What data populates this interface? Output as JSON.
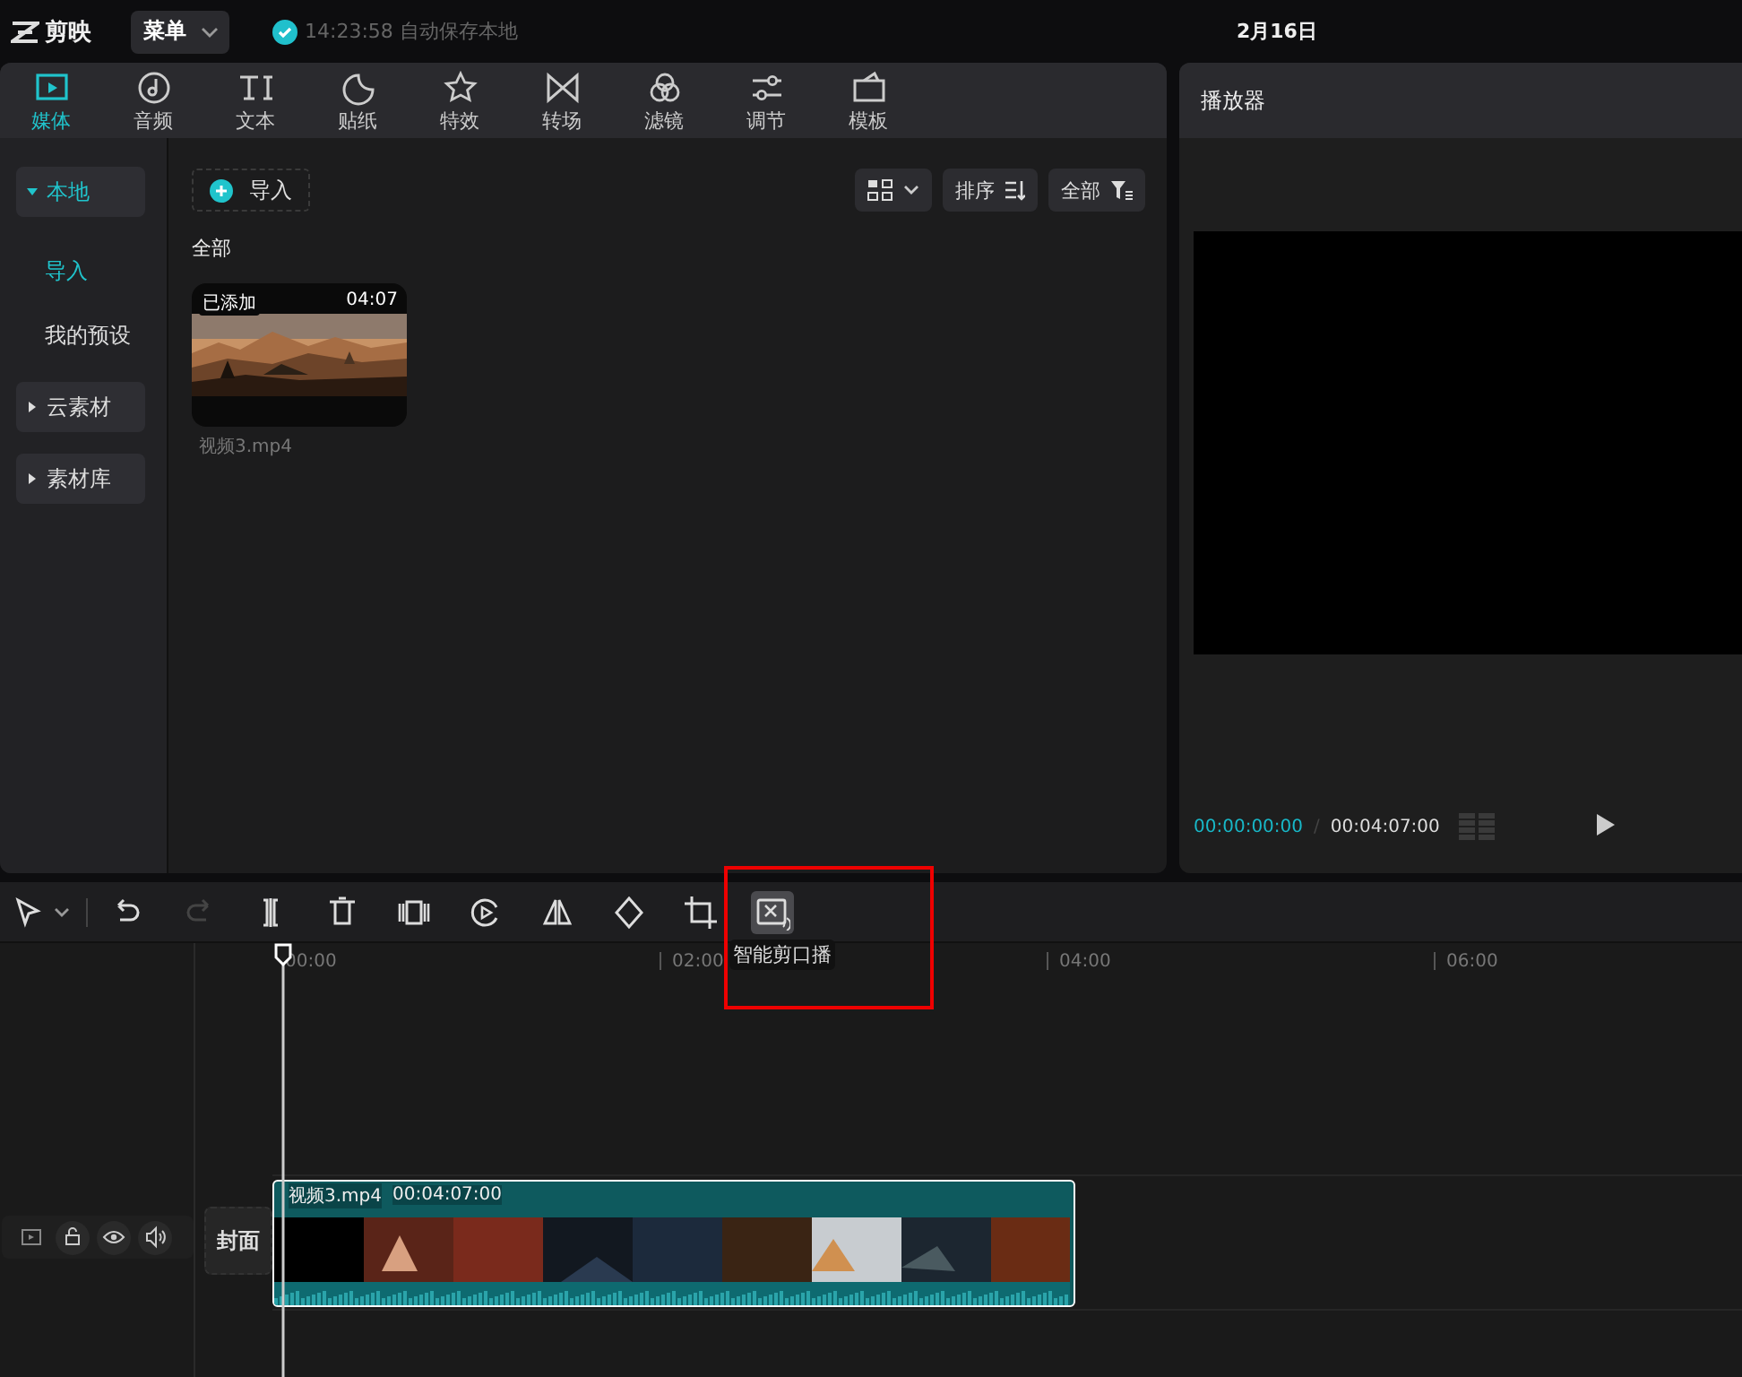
{
  "app": {
    "name": "剪映",
    "menu": "菜单",
    "save_status": "14:23:58 自动保存本地",
    "date": "2月16日"
  },
  "tabs": [
    {
      "label": "媒体",
      "selected": true
    },
    {
      "label": "音频",
      "selected": false
    },
    {
      "label": "文本",
      "selected": false
    },
    {
      "label": "贴纸",
      "selected": false
    },
    {
      "label": "特效",
      "selected": false
    },
    {
      "label": "转场",
      "selected": false
    },
    {
      "label": "滤镜",
      "selected": false
    },
    {
      "label": "调节",
      "selected": false
    },
    {
      "label": "模板",
      "selected": false
    }
  ],
  "sidebar": {
    "items": [
      {
        "label": "本地",
        "kind": "group",
        "expanded": true,
        "selected": true
      },
      {
        "label": "导入",
        "kind": "item",
        "selected": true
      },
      {
        "label": "我的预设",
        "kind": "item",
        "selected": false
      },
      {
        "label": "云素材",
        "kind": "group",
        "expanded": false,
        "selected": false
      },
      {
        "label": "素材库",
        "kind": "group",
        "expanded": false,
        "selected": false
      }
    ]
  },
  "media": {
    "import_button": "导入",
    "sort_button": "排序",
    "filter_button": "全部",
    "section_title": "全部",
    "items": [
      {
        "kind": "picture",
        "badge": "已添加",
        "duration": "04:07",
        "name": "视频3.mp4"
      }
    ]
  },
  "player": {
    "title": "播放器",
    "current_time": "00:00:00:00",
    "separator": "/",
    "total_time": "00:04:07:00"
  },
  "toolbar": {
    "tools": [
      {
        "kind": "select",
        "disabled": false,
        "active": false
      },
      {
        "kind": "undo",
        "disabled": false,
        "active": false
      },
      {
        "kind": "redo",
        "disabled": true,
        "active": false
      },
      {
        "kind": "split",
        "disabled": false,
        "active": false
      },
      {
        "kind": "delete",
        "disabled": false,
        "active": false
      },
      {
        "kind": "freeze",
        "disabled": false,
        "active": false
      },
      {
        "kind": "reverse",
        "disabled": false,
        "active": false
      },
      {
        "kind": "mirror",
        "disabled": false,
        "active": false
      },
      {
        "kind": "rotate",
        "disabled": false,
        "active": false
      },
      {
        "kind": "crop",
        "disabled": false,
        "active": false
      },
      {
        "kind": "smartcut",
        "disabled": false,
        "active": true
      }
    ],
    "tooltip": "智能剪口播"
  },
  "timeline": {
    "ruler": [
      "00:00",
      "02:00",
      "04:00",
      "06:00"
    ],
    "cover_label": "封面",
    "clip": {
      "name": "视频3.mp4",
      "duration": "00:04:07:00"
    }
  }
}
